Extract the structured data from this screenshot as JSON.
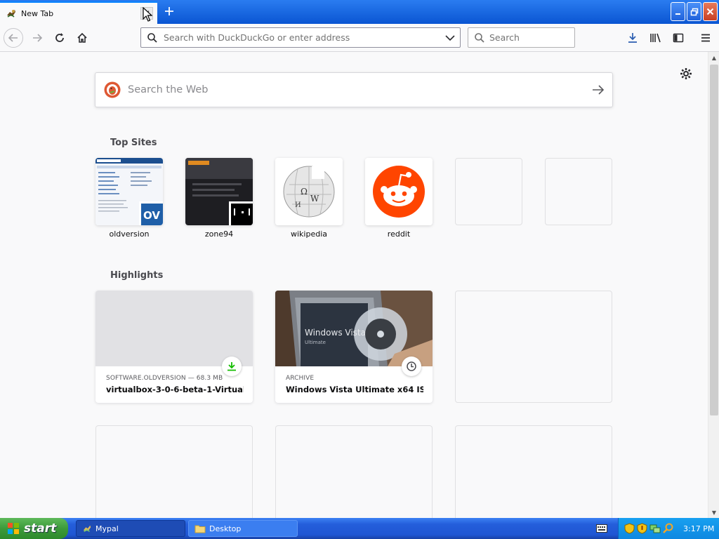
{
  "tab": {
    "title": "New Tab"
  },
  "navbar": {
    "url_placeholder": "Search with DuckDuckGo or enter address",
    "search_placeholder": "Search"
  },
  "newtab_page": {
    "web_search_placeholder": "Search the Web",
    "top_sites_title": "Top Sites",
    "top_sites": [
      {
        "label": "oldversion"
      },
      {
        "label": "zone94"
      },
      {
        "label": "wikipedia"
      },
      {
        "label": "reddit"
      },
      {
        "label": ""
      },
      {
        "label": ""
      }
    ],
    "highlights_title": "Highlights",
    "highlights": [
      {
        "context": "SOFTWARE.OLDVERSION — 68.3 MB",
        "title": "virtualbox-3-0-6-beta-1-Virtual...",
        "badge": "download-icon"
      },
      {
        "context": "ARCHIVE",
        "title": "Windows Vista Ultimate x64 ISO...",
        "badge": "clock-icon"
      }
    ]
  },
  "taskbar": {
    "start_label": "start",
    "tasks": [
      {
        "label": "Mypal"
      },
      {
        "label": "Desktop"
      }
    ],
    "clock": "3:17 PM"
  },
  "colors": {
    "accent": "#0a84ff",
    "reddit": "#ff4500",
    "duckduckgo": "#de5833",
    "download_green": "#12bc00"
  }
}
